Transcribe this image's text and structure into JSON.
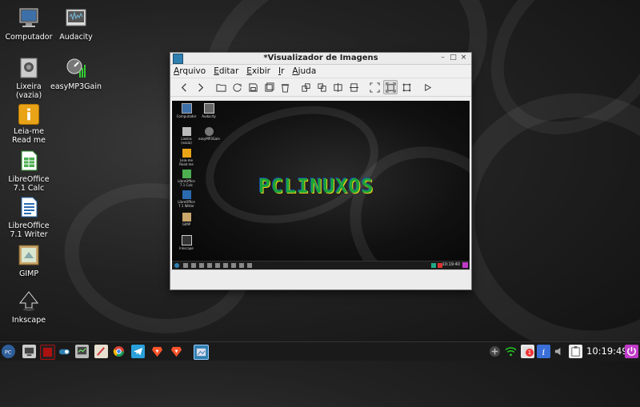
{
  "desktop": {
    "icons": [
      {
        "label": "Computador"
      },
      {
        "label": "Audacity"
      },
      {
        "label": "Lixeira\n(vazia)"
      },
      {
        "label": "easyMP3Gain"
      },
      {
        "label": "Leia-me Read me"
      },
      {
        "label": "LibreOffice 7.1 Calc"
      },
      {
        "label": "LibreOffice 7.1 Writer"
      },
      {
        "label": "GIMP"
      },
      {
        "label": "Inkscape"
      }
    ]
  },
  "window": {
    "title": "*Visualizador de Imagens",
    "menu": [
      "Arquivo",
      "Editar",
      "Exibir",
      "Ir",
      "Ajuda"
    ],
    "image": {
      "logo_text": "PCLINUXOS",
      "mini_icons": [
        "Computador",
        "Audacity",
        "Lixeira (vazia)",
        "easyMP3Gain",
        "Leia-me Read me",
        "LibreOffice 7.1 Calc",
        "LibreOffice 7.1 Writer",
        "GIMP",
        "Inkscape"
      ],
      "clock": "10:19:40"
    }
  },
  "taskbar": {
    "clock": "10:19:49",
    "notification_count": "1"
  },
  "colors": {
    "accent": "#2f7fb0",
    "logo_green": "#1aa33a",
    "logo_yellow": "#f2d21a",
    "logo_blue": "#1c3fa0",
    "power": "#c03ac8"
  }
}
